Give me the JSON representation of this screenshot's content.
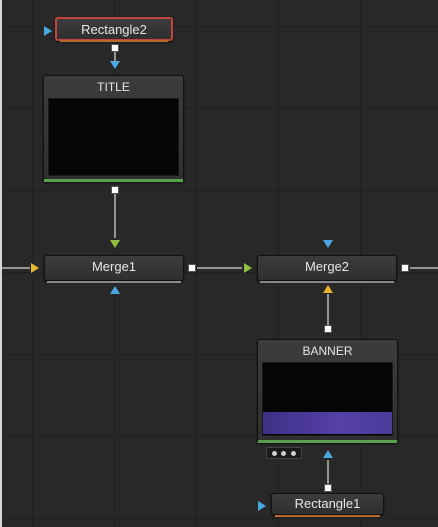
{
  "nodes": {
    "rectangle2": {
      "label": "Rectangle2"
    },
    "title": {
      "label": "TITLE"
    },
    "merge1": {
      "label": "Merge1"
    },
    "merge2": {
      "label": "Merge2"
    },
    "banner": {
      "label": "BANNER"
    },
    "rectangle1": {
      "label": "Rectangle1"
    }
  },
  "colors": {
    "background": "#282828",
    "selected_outline": "#c0443b",
    "foreground_input": "#8fc040",
    "background_input": "#e6b830",
    "mask_input": "#4aa8e0",
    "render_bar": "#59a04f",
    "banner_fill": "#4a3a9a"
  }
}
